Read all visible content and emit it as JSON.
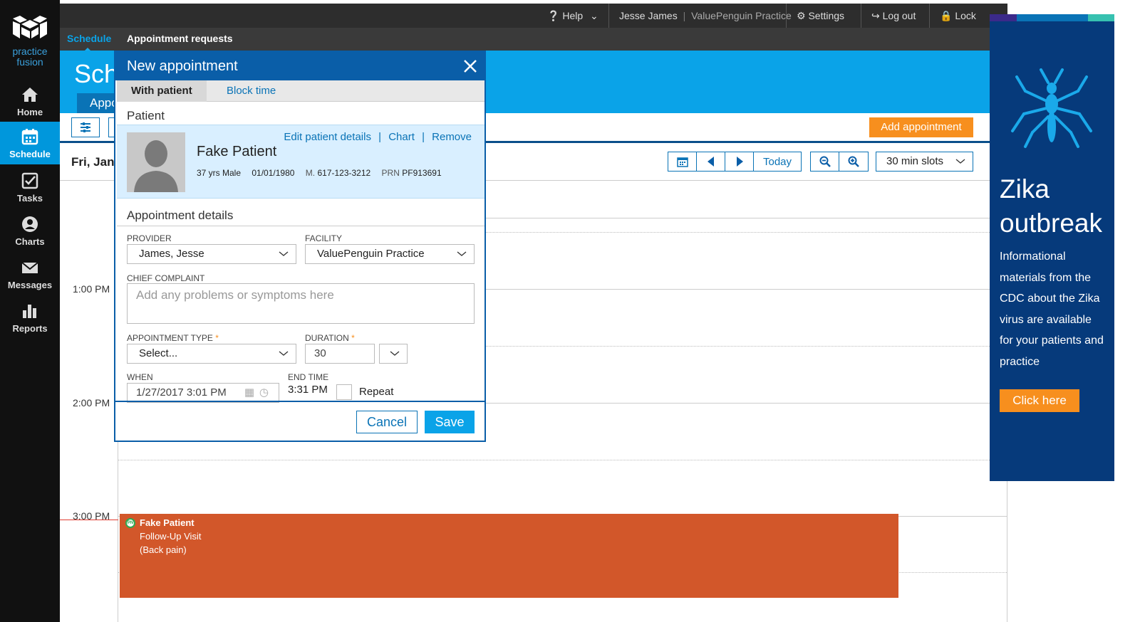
{
  "brand": {
    "name_line1": "practice",
    "name_line2": "fusion"
  },
  "nav": [
    {
      "label": "Home",
      "icon": "home-icon"
    },
    {
      "label": "Schedule",
      "icon": "calendar-icon"
    },
    {
      "label": "Tasks",
      "icon": "checkbox-icon"
    },
    {
      "label": "Charts",
      "icon": "person-icon"
    },
    {
      "label": "Messages",
      "icon": "envelope-icon"
    },
    {
      "label": "Reports",
      "icon": "bar-chart-icon"
    }
  ],
  "topbar": {
    "help": "Help",
    "user": "Jesse James",
    "practice": "ValuePenguin Practice",
    "settings": "Settings",
    "logout": "Log out",
    "lock": "Lock"
  },
  "subnav": {
    "schedule": "Schedule",
    "requests": "Appointment requests"
  },
  "page": {
    "title": "Sch",
    "tab": "Appo",
    "add_button": "Add appointment",
    "date": "Fri, Jan",
    "today": "Today",
    "slots": "30 min slots"
  },
  "grid": {
    "times": [
      "1:00 PM",
      "2:00 PM",
      "3:00 PM"
    ]
  },
  "event": {
    "badge": "PN",
    "name": "Fake Patient",
    "type": "Follow-Up Visit",
    "reason": "(Back pain)"
  },
  "ad": {
    "title_line1": "Zika",
    "title_line2": "outbreak",
    "body": "Informational materials from the CDC about the Zika virus are available for your patients and practice",
    "button": "Click here"
  },
  "modal": {
    "title": "New appointment",
    "tabs": [
      "With patient",
      "Block time"
    ],
    "patient_section": "Patient",
    "links": {
      "edit": "Edit patient details",
      "chart": "Chart",
      "remove": "Remove"
    },
    "patient": {
      "name": "Fake Patient",
      "age_sex": "37 yrs Male",
      "dob": "01/01/1980",
      "phone_label": "M.",
      "phone": "617-123-3212",
      "prn_label": "PRN",
      "prn": "PF913691"
    },
    "details_section": "Appointment details",
    "provider_label": "PROVIDER",
    "provider_value": "James, Jesse",
    "facility_label": "FACILITY",
    "facility_value": "ValuePenguin Practice",
    "complaint_label": "CHIEF COMPLAINT",
    "complaint_placeholder": "Add any problems or symptoms here",
    "appt_type_label": "APPOINTMENT TYPE",
    "appt_type_value": "Select...",
    "duration_label": "DURATION",
    "duration_value": "30",
    "when_label": "WHEN",
    "when_value": "1/27/2017 3:01 PM",
    "end_time_label": "END TIME",
    "end_time_value": "3:31 PM",
    "repeat_label": "Repeat",
    "cancel": "Cancel",
    "save": "Save"
  },
  "colors": {
    "accent": "#0aa3e8",
    "modal_header": "#0a5ea8",
    "orange": "#f78f1e",
    "event": "#d2572a",
    "ad_bg": "#063a7b"
  }
}
